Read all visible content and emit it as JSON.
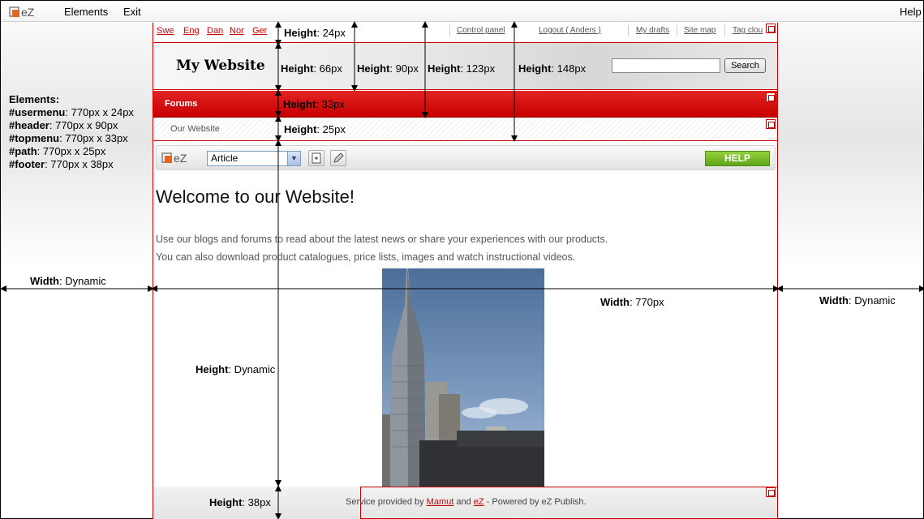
{
  "menubar": {
    "elements": "Elements",
    "exit": "Exit",
    "help": "Help"
  },
  "logo_text": "eZ",
  "legend": {
    "title": "Elements:",
    "items": [
      {
        "id": "#usermenu",
        "dims": ": 770px x 24px"
      },
      {
        "id": "#header",
        "dims": ": 770px x 90px"
      },
      {
        "id": "#topmenu",
        "dims": ": 770px x 33px"
      },
      {
        "id": "#path",
        "dims": ": 770px x 25px"
      },
      {
        "id": "#footer",
        "dims": ": 770px x 38px"
      }
    ]
  },
  "usermenu": {
    "languages": [
      "Swe",
      "Eng",
      "Dan",
      "Nor",
      "Ger"
    ],
    "links": [
      "Control panel",
      "Logout ( Anders )",
      "My drafts",
      "Site map",
      "Tag clou"
    ]
  },
  "header": {
    "title": "My Website",
    "search_button": "Search",
    "search_value": ""
  },
  "topmenu": {
    "item": "Forums"
  },
  "path": {
    "item": "Our Website"
  },
  "toolbar": {
    "class_select": "Article",
    "help": "HELP"
  },
  "content": {
    "heading": "Welcome to our Website!",
    "para1": "Use our blogs and forums to read about the latest news or share your experiences with our products.",
    "para2": "You can also download product catalogues, price lists, images and watch instructional videos."
  },
  "footer": {
    "prefix": "Service provided by ",
    "link1": "Mamut",
    "middle": " and ",
    "link2": "eZ",
    "suffix": " - Powered by eZ Publish."
  },
  "measurements": {
    "height_word": "Height",
    "width_word": "Width",
    "h24": ": 24px",
    "h66": ": 66px",
    "h90": ": 90px",
    "h123": ": 123px",
    "h148": ": 148px",
    "h33": ": 33px",
    "h25": ": 25px",
    "h_dynamic": ": Dynamic",
    "h38": ": 38px",
    "w_left": ": Dynamic",
    "w_center": ": 770px",
    "w_right": ": Dynamic"
  },
  "colors": {
    "accent_red": "#cc0000",
    "help_green": "#6bb224"
  }
}
